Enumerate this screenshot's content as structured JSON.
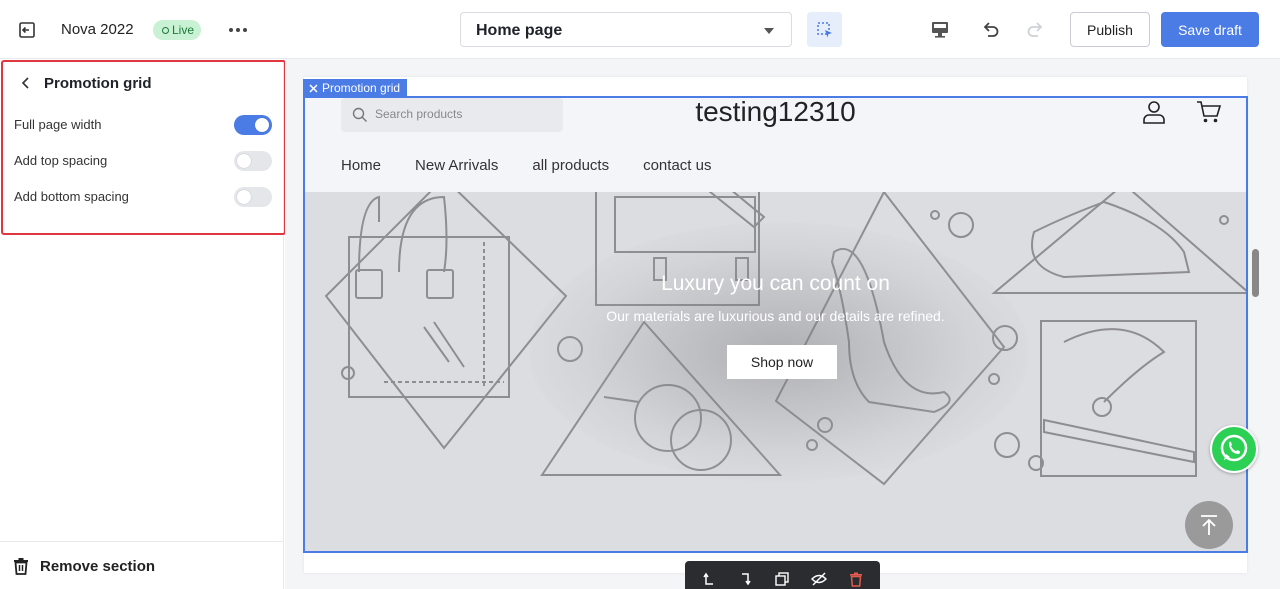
{
  "topbar": {
    "theme_name": "Nova 2022",
    "status_badge": "Live",
    "page_select": {
      "value": "Home page"
    },
    "publish_label": "Publish",
    "save_draft_label": "Save draft",
    "accent_color": "#4b7be5"
  },
  "sidebar": {
    "title": "Promotion grid",
    "options": [
      {
        "label": "Full page width",
        "enabled": true
      },
      {
        "label": "Add top spacing",
        "enabled": false
      },
      {
        "label": "Add bottom spacing",
        "enabled": false
      }
    ],
    "remove_label": "Remove section"
  },
  "canvas": {
    "selection_tag": "Promotion grid",
    "store": {
      "search_placeholder": "Search products",
      "logo": "testing12310",
      "nav": [
        "Home",
        "New Arrivals",
        "all products",
        "contact us"
      ]
    },
    "hero": {
      "title": "Luxury you can count on",
      "subtitle": "Our materials are luxurious and our details are refined.",
      "button": "Shop now"
    },
    "toolbar_icons": [
      "move-up-icon",
      "move-down-icon",
      "duplicate-icon",
      "hide-icon",
      "delete-icon"
    ]
  }
}
